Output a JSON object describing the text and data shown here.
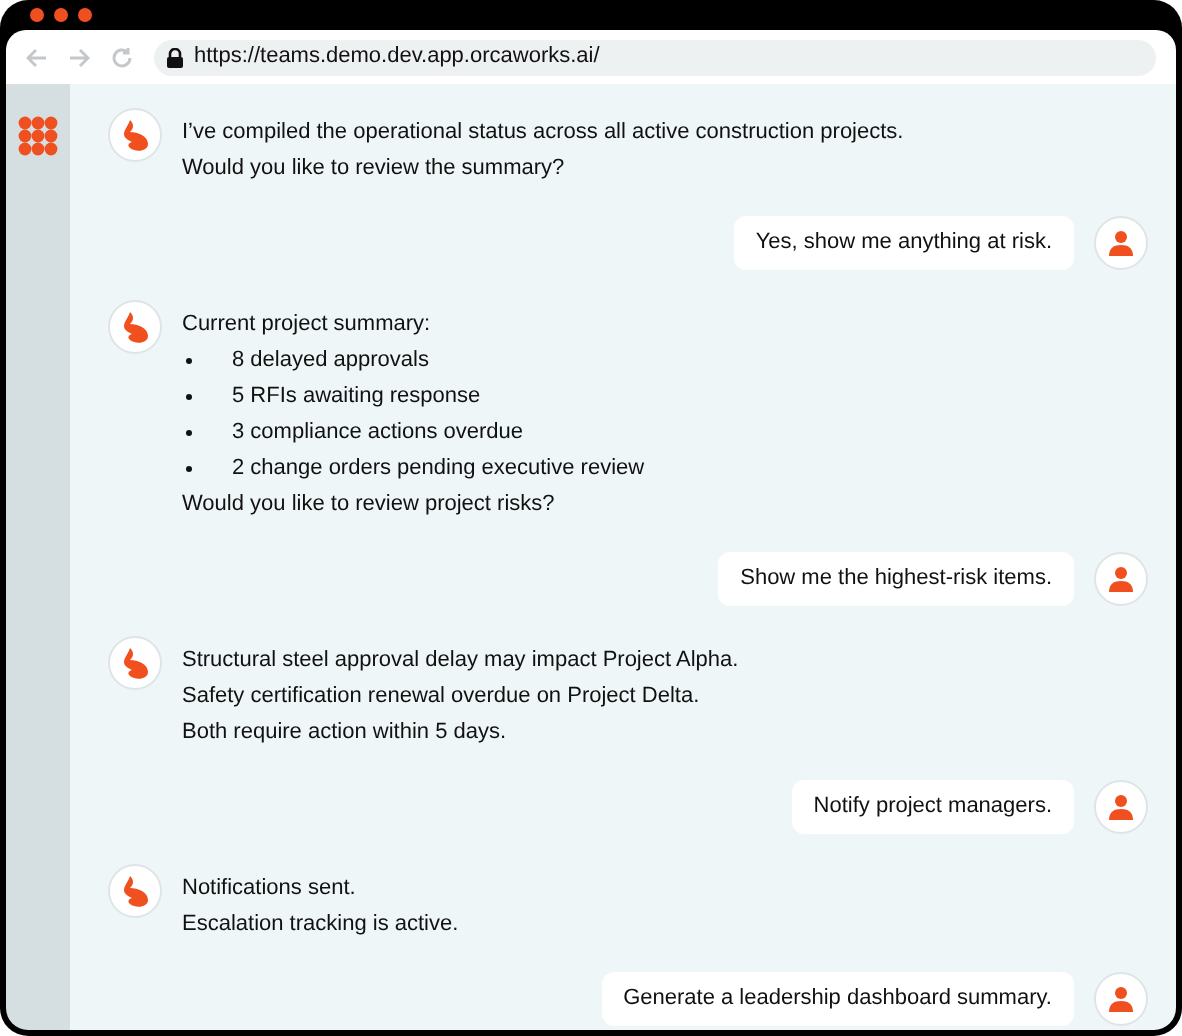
{
  "browser": {
    "url": "https://teams.demo.dev.app.orcaworks.ai/"
  },
  "messages": [
    {
      "kind": "assistant",
      "lines": [
        {
          "kind": "text",
          "text": "I’ve compiled the operational status across all active construction projects."
        },
        {
          "kind": "text",
          "text": "Would you like to review the summary?"
        }
      ]
    },
    {
      "kind": "user",
      "text": "Yes, show me anything at risk."
    },
    {
      "kind": "assistant",
      "lines": [
        {
          "kind": "text",
          "text": "Current project summary:"
        },
        {
          "kind": "bullet",
          "text": "8 delayed approvals"
        },
        {
          "kind": "bullet",
          "text": "5 RFIs awaiting response"
        },
        {
          "kind": "bullet",
          "text": "3 compliance actions overdue"
        },
        {
          "kind": "bullet",
          "text": "2 change orders pending executive review"
        },
        {
          "kind": "text",
          "text": "Would you like to review project risks?"
        }
      ]
    },
    {
      "kind": "user",
      "text": "Show me the highest-risk items."
    },
    {
      "kind": "assistant",
      "lines": [
        {
          "kind": "text",
          "text": "Structural steel approval delay may impact Project Alpha."
        },
        {
          "kind": "text",
          "text": "Safety certification renewal overdue on Project Delta."
        },
        {
          "kind": "text",
          "text": "Both require action within 5 days."
        }
      ]
    },
    {
      "kind": "user",
      "text": "Notify project managers."
    },
    {
      "kind": "assistant",
      "lines": [
        {
          "kind": "text",
          "text": "Notifications sent."
        },
        {
          "kind": "text",
          "text": "Escalation tracking is active."
        }
      ]
    },
    {
      "kind": "user",
      "text": "Generate a leadership dashboard summary."
    }
  ]
}
